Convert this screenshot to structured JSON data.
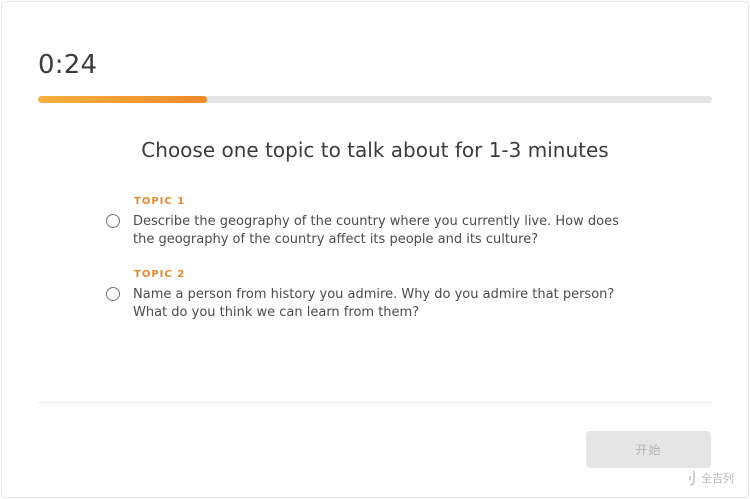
{
  "timer": {
    "value": "0:24"
  },
  "progress": {
    "fraction": 0.25
  },
  "heading": "Choose one topic to talk about for 1-3 minutes",
  "topics": [
    {
      "label": "TOPIC 1",
      "text": "Describe the geography of the country where you currently live. How does the geography of the country affect its people and its culture?",
      "selected": false
    },
    {
      "label": "TOPIC 2",
      "text": "Name a person from history you admire. Why do you admire that person? What do you think we can learn from them?",
      "selected": false
    }
  ],
  "start_button": {
    "label": "开始",
    "enabled": false
  },
  "watermark": {
    "text": "全吉列"
  },
  "colors": {
    "accent": "#ee8a2c",
    "topic_label": "#e28a31",
    "track": "#e5e5e5"
  }
}
